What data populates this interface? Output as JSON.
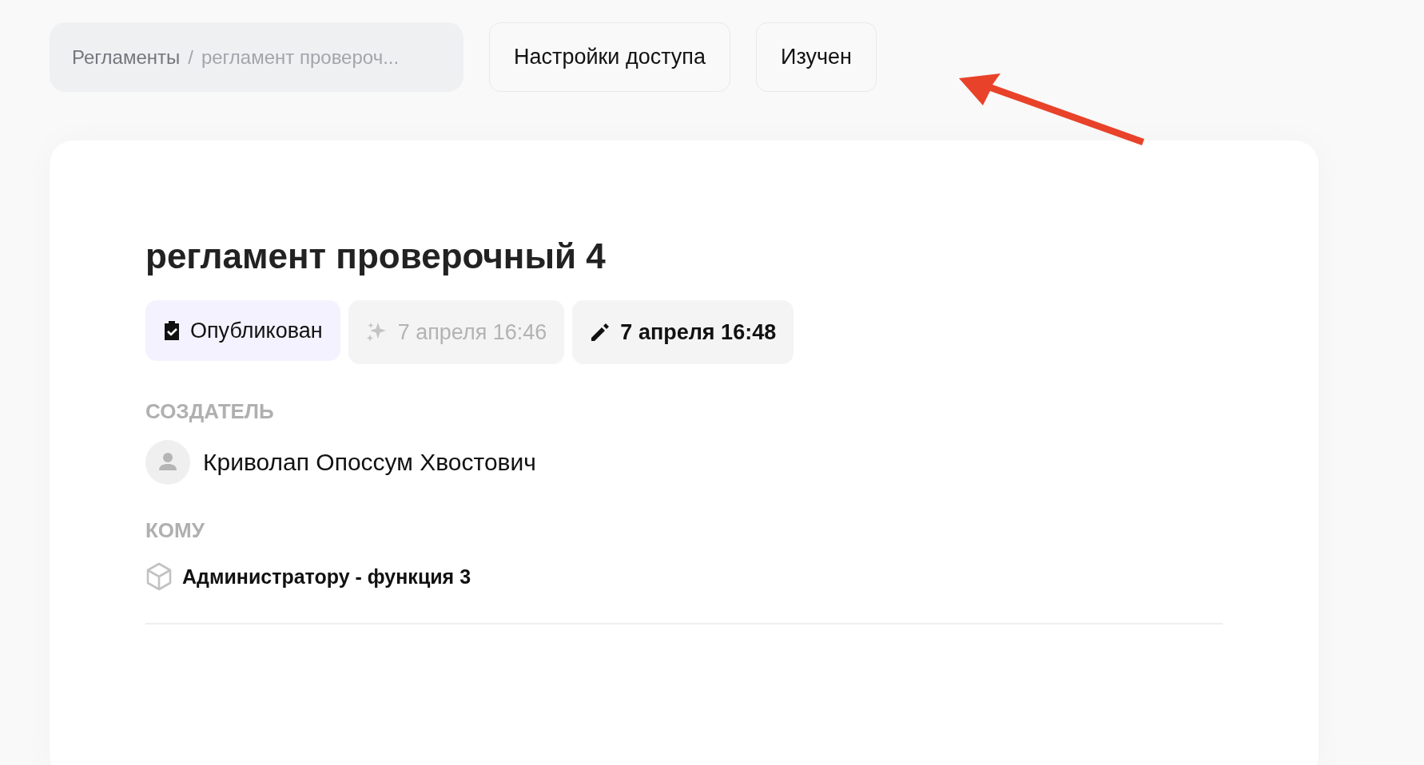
{
  "breadcrumb": {
    "items": [
      {
        "label": "Регламенты"
      },
      {
        "label": "регламент провероч..."
      }
    ],
    "separator": "/"
  },
  "actions": [
    {
      "label": "Настройки доступа"
    },
    {
      "label": "Изучен"
    }
  ],
  "document": {
    "title": "регламент проверочный 4",
    "chips": [
      {
        "kind": "status",
        "label": "Опубликован"
      },
      {
        "kind": "created",
        "label": "7 апреля 16:46"
      },
      {
        "kind": "edited",
        "label": "7 апреля 16:48"
      }
    ],
    "creator": {
      "heading": "СОЗДАТЕЛЬ",
      "name": "Криволап Опоссум Хвостович"
    },
    "recipients": {
      "heading": "КОМУ",
      "items": [
        {
          "label": "Администратору - функция 3"
        }
      ]
    }
  }
}
